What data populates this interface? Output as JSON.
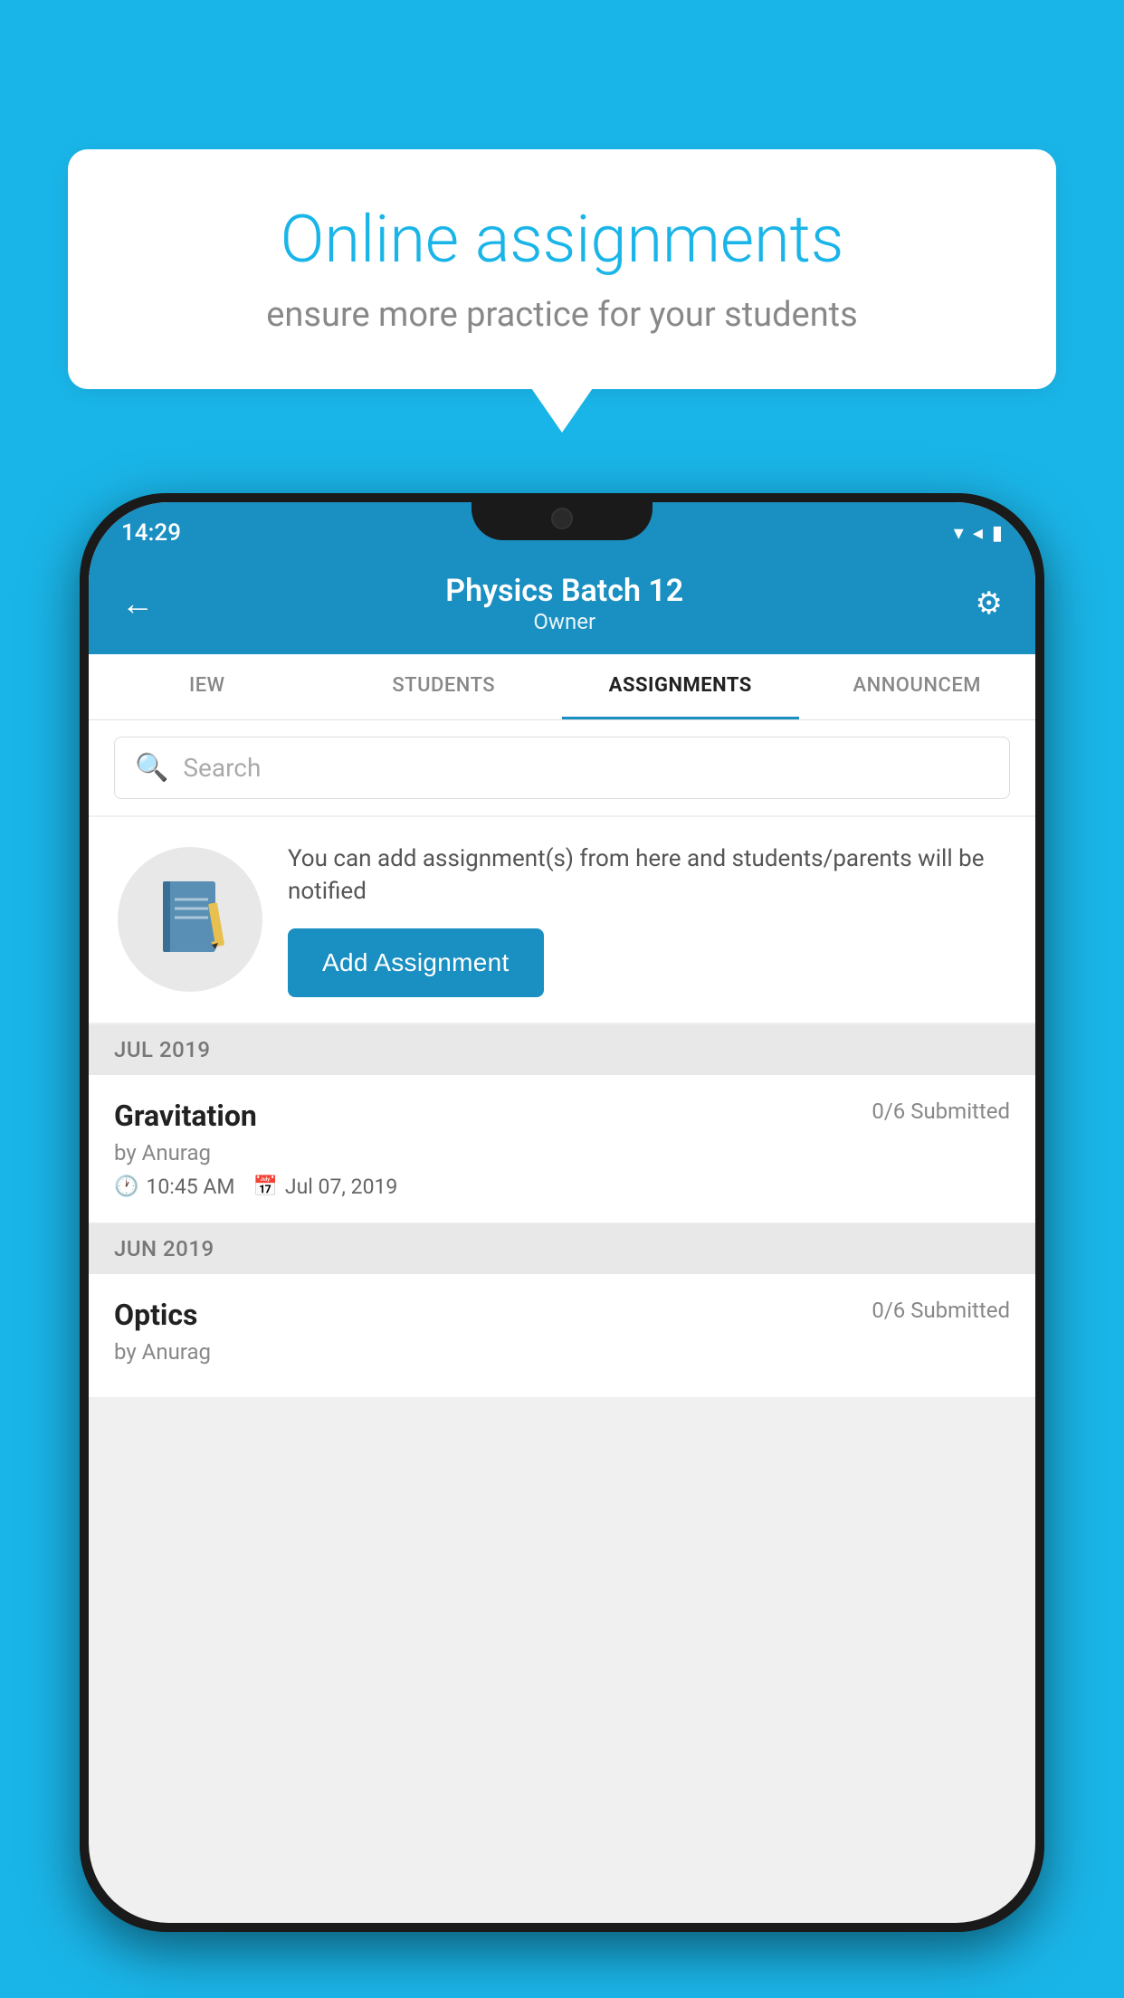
{
  "background_color": "#1ab5e8",
  "speech_bubble": {
    "title": "Online assignments",
    "subtitle": "ensure more practice for your students"
  },
  "phone": {
    "status_bar": {
      "time": "14:29",
      "icons": [
        "wifi",
        "signal",
        "battery"
      ]
    },
    "header": {
      "title": "Physics Batch 12",
      "subtitle": "Owner",
      "back_label": "←",
      "settings_label": "⚙"
    },
    "tabs": [
      {
        "label": "IEW",
        "active": false
      },
      {
        "label": "STUDENTS",
        "active": false
      },
      {
        "label": "ASSIGNMENTS",
        "active": true
      },
      {
        "label": "ANNOUNCEM",
        "active": false
      }
    ],
    "search": {
      "placeholder": "Search"
    },
    "promo": {
      "description": "You can add assignment(s) from here and students/parents will be notified",
      "button_label": "Add Assignment"
    },
    "sections": [
      {
        "label": "JUL 2019",
        "assignments": [
          {
            "title": "Gravitation",
            "submitted": "0/6 Submitted",
            "author": "by Anurag",
            "time": "10:45 AM",
            "date": "Jul 07, 2019"
          }
        ]
      },
      {
        "label": "JUN 2019",
        "assignments": [
          {
            "title": "Optics",
            "submitted": "0/6 Submitted",
            "author": "by Anurag",
            "time": "",
            "date": ""
          }
        ]
      }
    ]
  }
}
